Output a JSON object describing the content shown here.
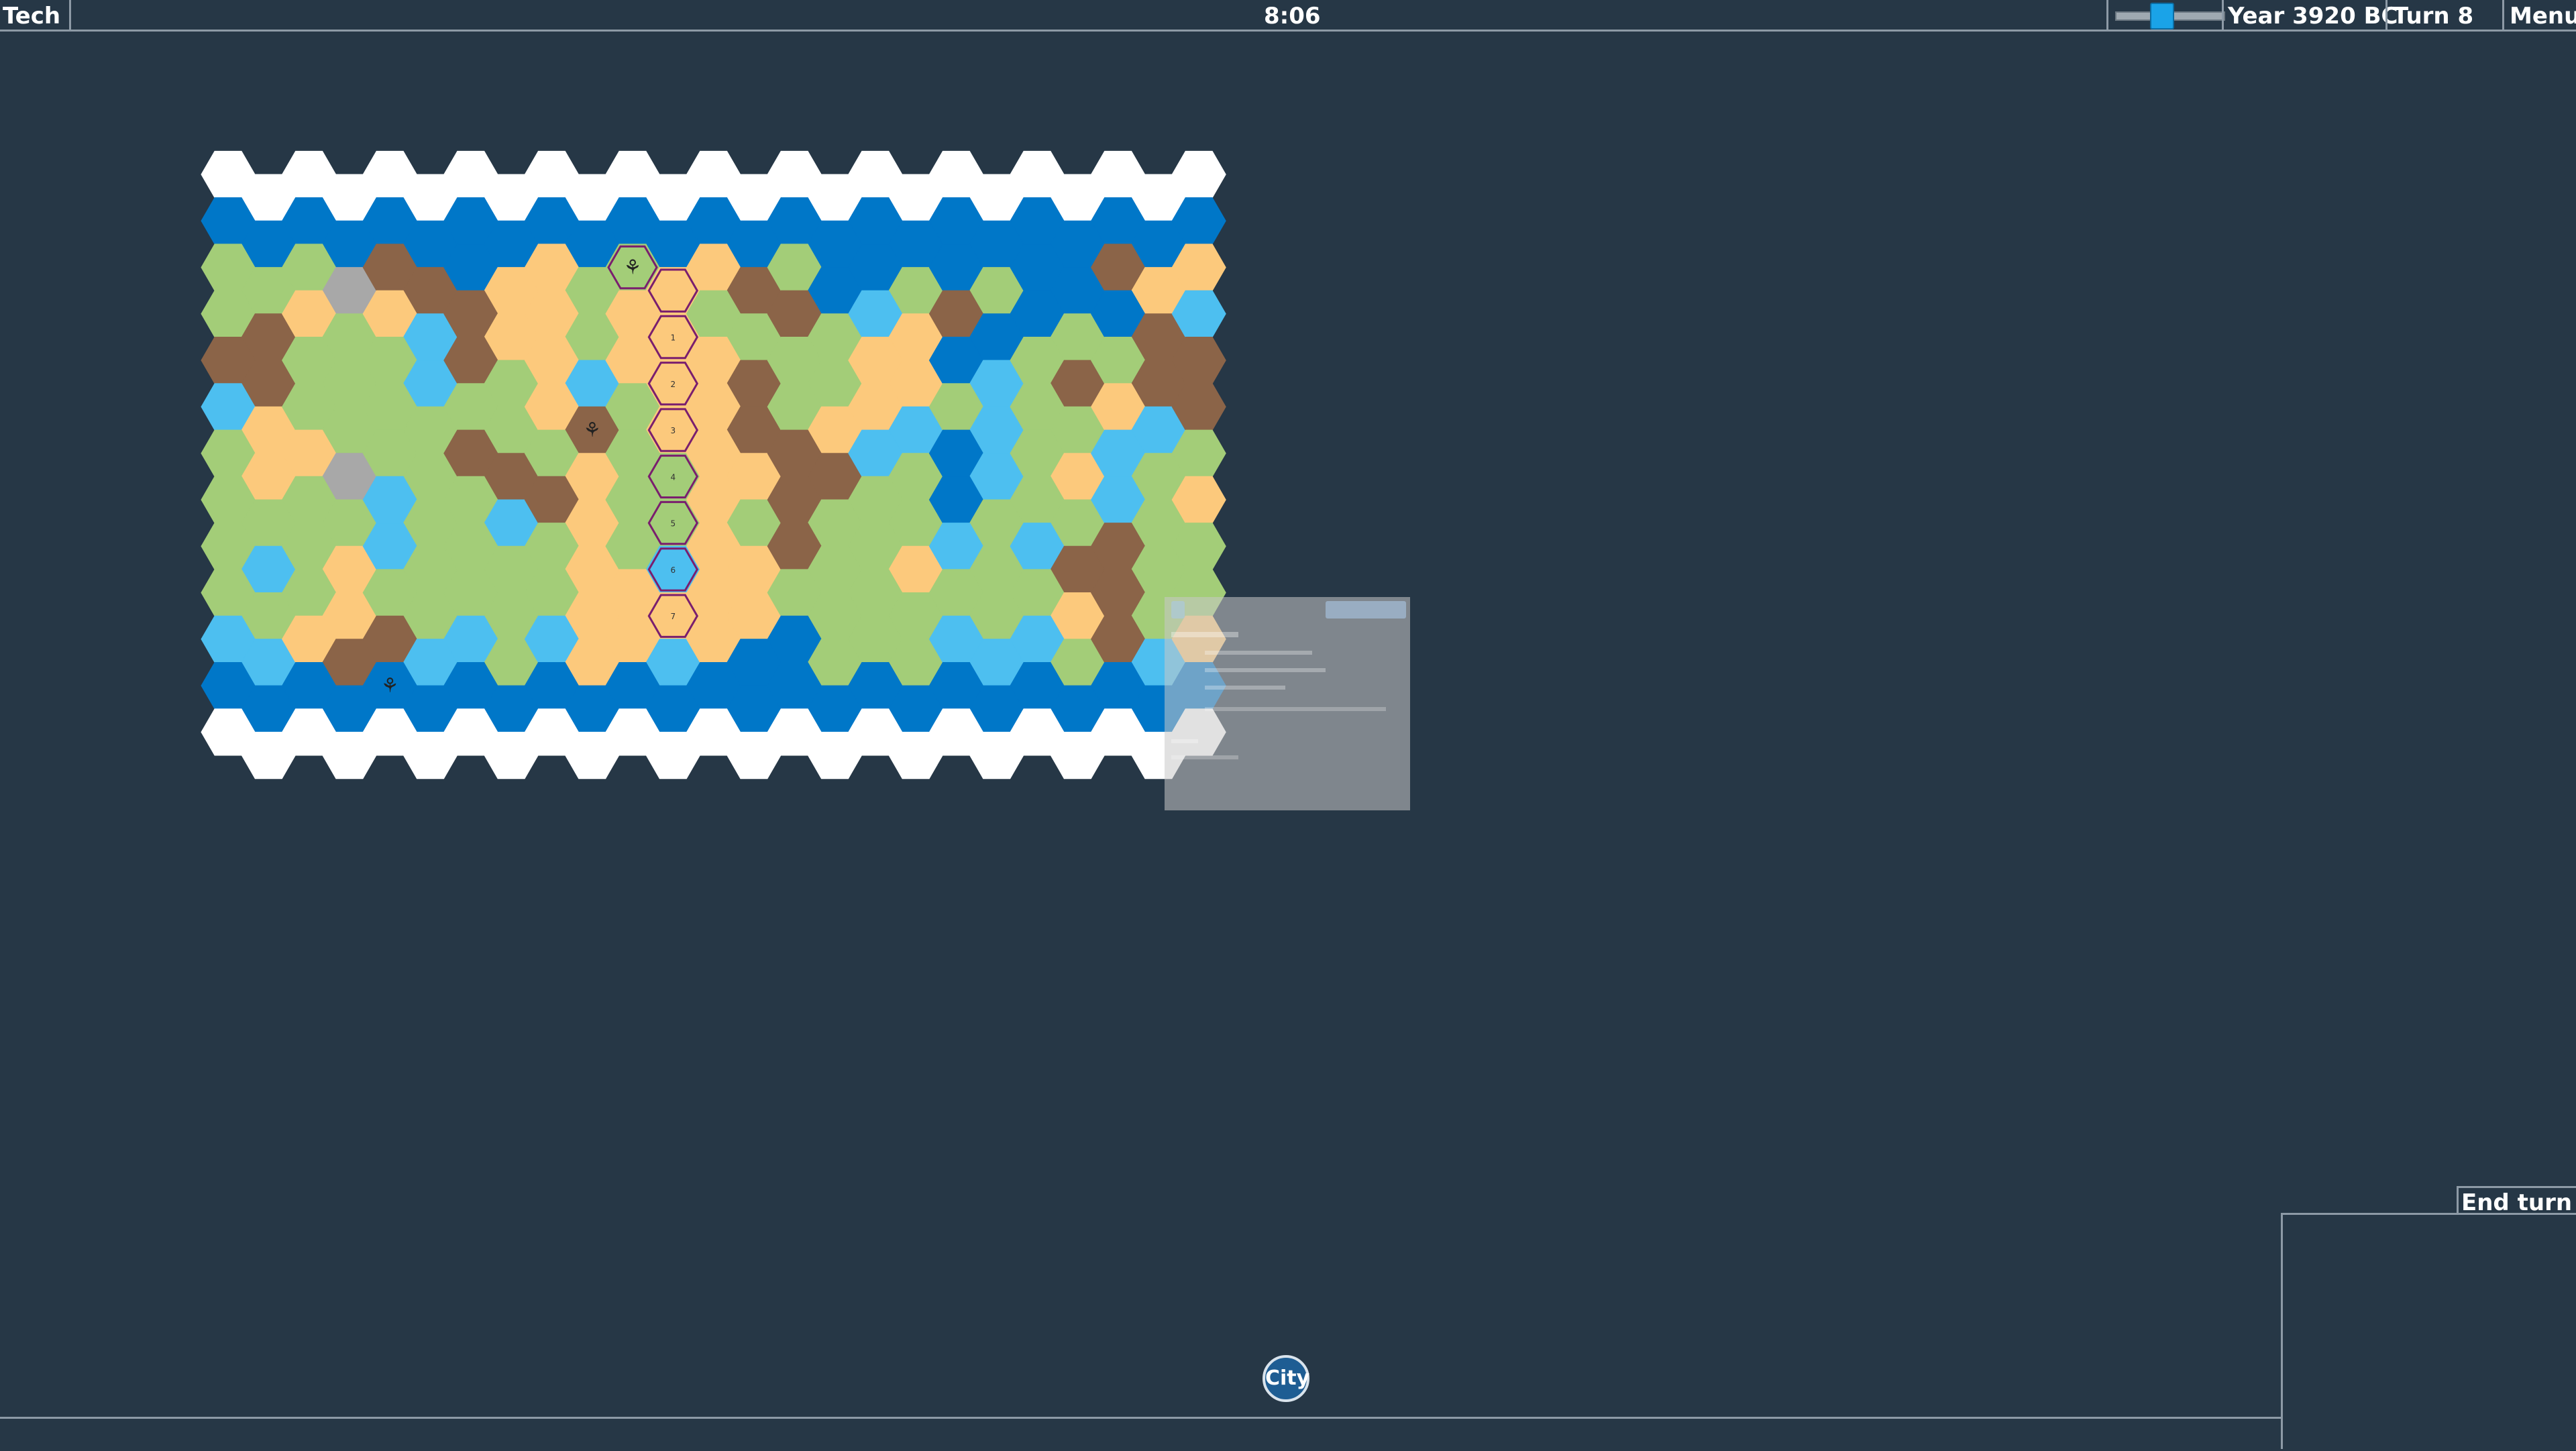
{
  "topbar": {
    "tech_label": "Tech",
    "clock": "8:06",
    "year": "Year 3920 BC",
    "turn": "Turn 8",
    "menu_label": "Menu"
  },
  "zoom": {
    "level": 0.4
  },
  "end_turn_label": "End turn",
  "city_button_label": "City",
  "colors": {
    "snow": "#ffffff",
    "deep_ocean": "#0077c8",
    "coast": "#4dbff0",
    "grassland": "#a3cd78",
    "desert": "#fcc97c",
    "hills": "#8b6448",
    "mountain": "#a8a8a8",
    "background": "#263746",
    "path_border": "#7a1e6e"
  },
  "terrain_legend": {
    "S": "snow",
    "O": "deep_ocean",
    "C": "coast",
    "G": "grassland",
    "D": "desert",
    "H": "hills",
    "M": "mountain"
  },
  "map": {
    "rows": [
      "SSSSSSSSSSSSSSSSSSSSSSSSS",
      "OOOOOOOOOOOOOOOOOOOOOOOOO",
      "GGGMHHODDGGDDHGOOGOGOOHDD",
      "GHDGDCHDDGDDGGHGCDHOOGOHC",
      "HHGGGCHGDCDDDHGGDDOCGHGHH",
      "CDGGGGGGDHGDDHGDDCGCGGDCH",
      "GDDMGGHHGDGGDDHHCGOCGDCGG",
      "GGGGCGGCHDGGDGHGGGOGGGCGD",
      "GCGDCGGGGDGCDDHGGDCGCHHGG",
      "GGGDGGGGGDDDDDGGGGGGGDHGG",
      "CCDHHCCGCDDCDOOGGGCCCGHCD",
      "OOOOOOOOOOOOOOOOOOOOOOOOO",
      "SSSSSSSSSSSSSSSSSSSSSSSSS"
    ]
  },
  "path_numbers": [
    "1",
    "2",
    "3",
    "4",
    "5",
    "6",
    "7"
  ],
  "units": [
    {
      "name": "settler-unit-1"
    },
    {
      "name": "settler-unit-2"
    },
    {
      "name": "settler-unit-3"
    }
  ]
}
